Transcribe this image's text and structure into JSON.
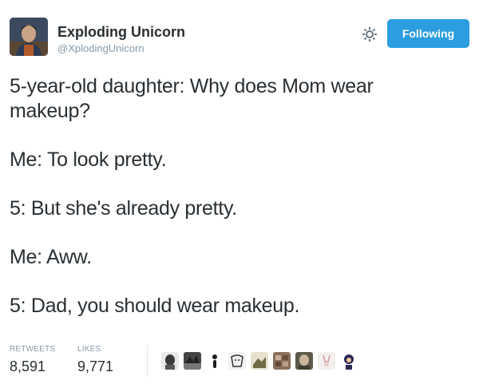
{
  "author": {
    "display_name": "Exploding Unicorn",
    "handle": "@XplodingUnicorn",
    "avatar_icon": "user-photo-avatar"
  },
  "actions": {
    "settings_icon": "gear-icon",
    "follow_label": "Following",
    "follow_color": "#2b9de0"
  },
  "tweet": {
    "lines": [
      "5-year-old daughter: Why does Mom wear makeup?",
      "Me: To look pretty.",
      "5: But she's already pretty.",
      "Me: Aww.",
      "5: Dad, you should wear makeup."
    ]
  },
  "stats": {
    "retweets_label": "RETWEETS",
    "retweets_value": "8,591",
    "likes_label": "LIKES",
    "likes_value": "9,771"
  },
  "likers": [
    {
      "icon": "liker-avatar-1",
      "color": "#3a3a3a"
    },
    {
      "icon": "liker-avatar-2",
      "color": "#2f2f2f"
    },
    {
      "icon": "liker-avatar-3",
      "color": "#1c1c1c"
    },
    {
      "icon": "liker-avatar-4",
      "color": "#d9d9d9"
    },
    {
      "icon": "liker-avatar-5",
      "color": "#6d6a44"
    },
    {
      "icon": "liker-avatar-6",
      "color": "#8a6f5a"
    },
    {
      "icon": "liker-avatar-7",
      "color": "#5b5a48"
    },
    {
      "icon": "liker-avatar-8",
      "color": "#e8e0e0"
    },
    {
      "icon": "liker-avatar-9",
      "color": "#2a2a55"
    }
  ]
}
